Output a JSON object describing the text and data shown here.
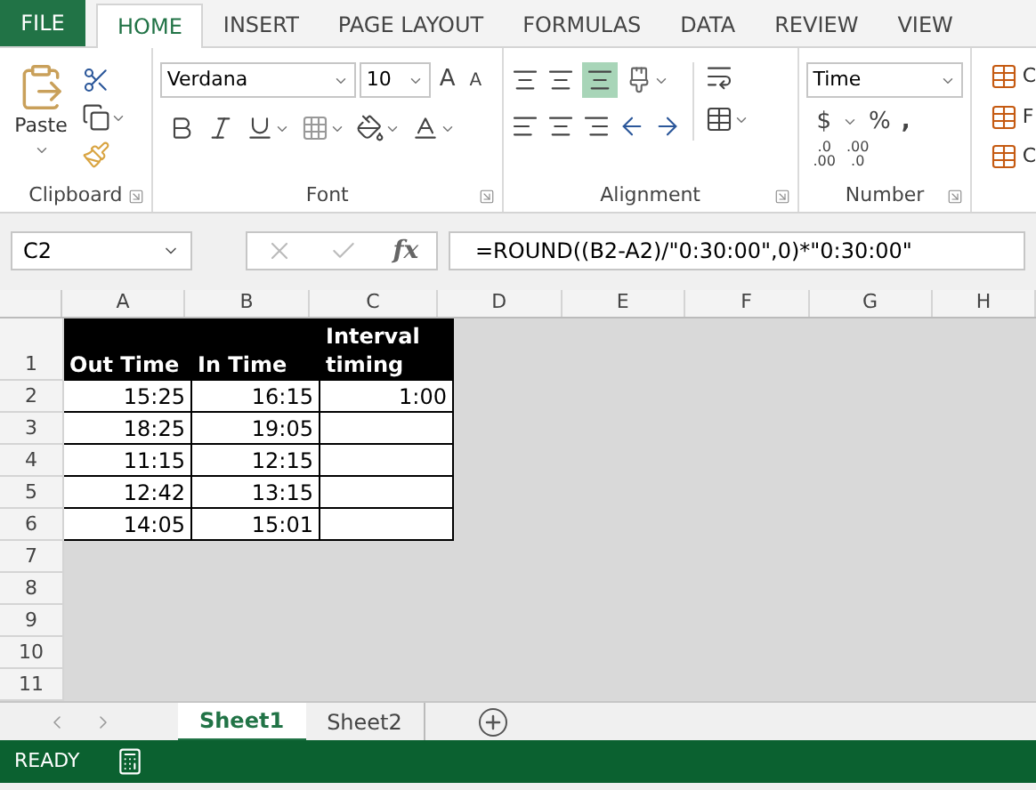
{
  "menu_tabs": [
    {
      "label": "FILE",
      "kind": "file",
      "selected": false
    },
    {
      "label": "HOME",
      "kind": "tab",
      "selected": true
    },
    {
      "label": "INSERT",
      "kind": "tab",
      "selected": false
    },
    {
      "label": "PAGE LAYOUT",
      "kind": "tab",
      "selected": false
    },
    {
      "label": "FORMULAS",
      "kind": "tab",
      "selected": false
    },
    {
      "label": "DATA",
      "kind": "tab",
      "selected": false
    },
    {
      "label": "REVIEW",
      "kind": "tab",
      "selected": false
    },
    {
      "label": "VIEW",
      "kind": "tab",
      "selected": false
    }
  ],
  "ribbon": {
    "clipboard": {
      "paste": "Paste",
      "label": "Clipboard"
    },
    "font": {
      "name": "Verdana",
      "size": "10",
      "grow": "A",
      "shrink": "A",
      "label": "Font"
    },
    "alignment": {
      "label": "Alignment"
    },
    "number": {
      "format": "Time",
      "currency": "$",
      "percent": "%",
      "comma": ",",
      "decimals": [
        [
          ".0",
          ".00"
        ],
        [
          ".00",
          ".0"
        ]
      ],
      "label": "Number"
    },
    "styles": [
      "C",
      "F",
      "C"
    ]
  },
  "name_box": "C2",
  "fx": "fx",
  "formula": "=ROUND((B2-A2)/\"0:30:00\",0)*\"0:30:00\"",
  "columns": [
    "A",
    "B",
    "C",
    "D",
    "E",
    "F",
    "G",
    "H"
  ],
  "rows": [
    {
      "number": "1",
      "kind": "header",
      "cells": [
        "Out Time",
        "In Time",
        "Interval timing"
      ]
    },
    {
      "number": "2",
      "kind": "data",
      "cells": [
        "15:25",
        "16:15",
        "1:00"
      ]
    },
    {
      "number": "3",
      "kind": "data",
      "cells": [
        "18:25",
        "19:05",
        ""
      ]
    },
    {
      "number": "4",
      "kind": "data",
      "cells": [
        "11:15",
        "12:15",
        ""
      ]
    },
    {
      "number": "5",
      "kind": "data",
      "cells": [
        "12:42",
        "13:15",
        ""
      ]
    },
    {
      "number": "6",
      "kind": "data",
      "cells": [
        "14:05",
        "15:01",
        ""
      ]
    },
    {
      "number": "7",
      "kind": "empty",
      "cells": []
    },
    {
      "number": "8",
      "kind": "empty",
      "cells": []
    },
    {
      "number": "9",
      "kind": "empty",
      "cells": []
    },
    {
      "number": "10",
      "kind": "empty",
      "cells": []
    },
    {
      "number": "11",
      "kind": "empty",
      "cells": []
    }
  ],
  "sheet_tabs": [
    {
      "label": "Sheet1",
      "selected": true
    },
    {
      "label": "Sheet2",
      "selected": false
    }
  ],
  "status": "READY"
}
